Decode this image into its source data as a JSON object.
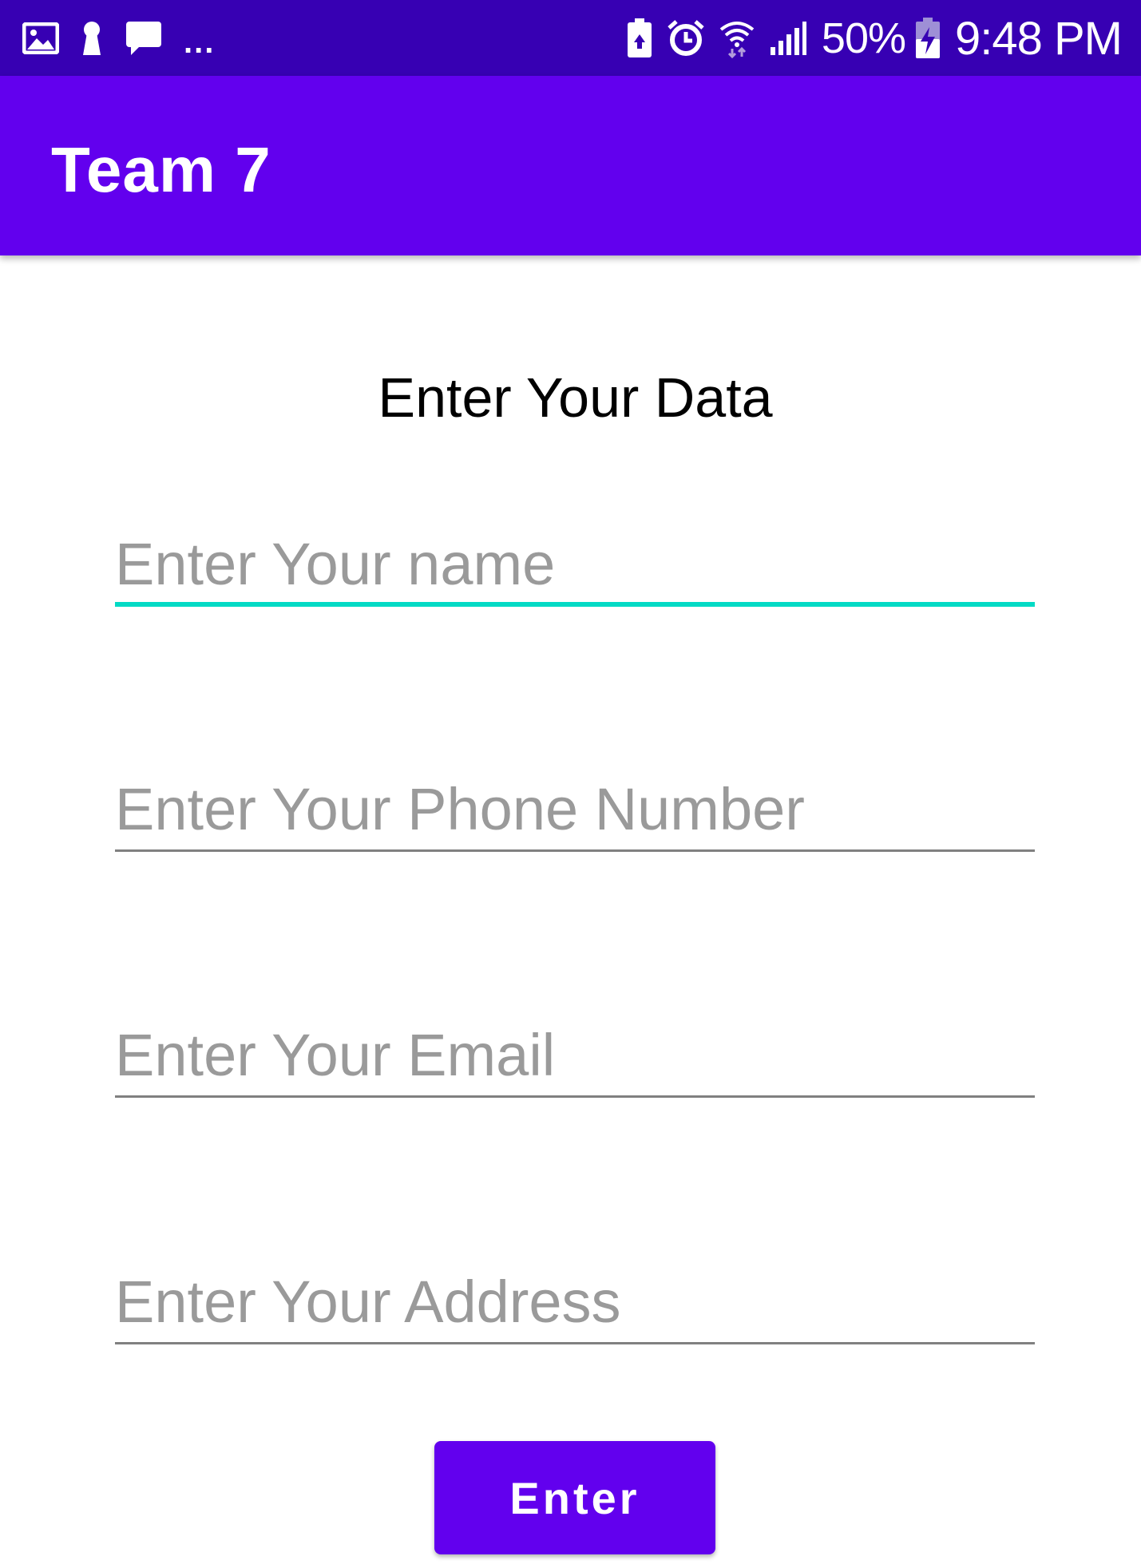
{
  "status_bar": {
    "left_icons": [
      "gallery-icon",
      "keyhole-icon",
      "chat-icon"
    ],
    "overflow": "...",
    "right_icons": [
      "battery-saver-icon",
      "alarm-icon",
      "wifi-icon",
      "signal-icon"
    ],
    "battery_percent": "50%",
    "time": "9:48 PM",
    "background_color": "#3700b3"
  },
  "app_bar": {
    "title": "Team 7",
    "background_color": "#6200ee"
  },
  "form": {
    "heading": "Enter Your Data",
    "fields": [
      {
        "placeholder": "Enter Your name",
        "value": "",
        "focused": true
      },
      {
        "placeholder": "Enter Your Phone Number",
        "value": "",
        "focused": false
      },
      {
        "placeholder": "Enter Your Email",
        "value": "",
        "focused": false
      },
      {
        "placeholder": "Enter Your Address",
        "value": "",
        "focused": false
      }
    ],
    "submit_label": "Enter",
    "accent_color": "#03dac5"
  }
}
